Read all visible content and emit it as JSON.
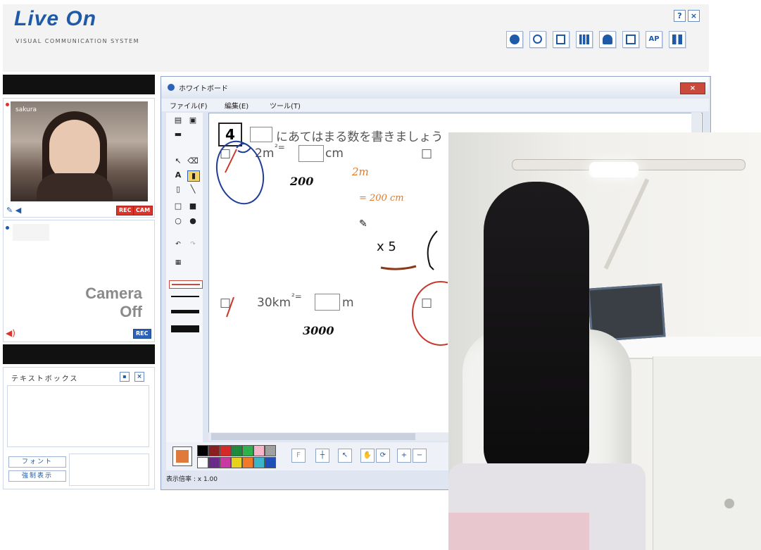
{
  "app": {
    "logo": "Live On",
    "tagline": "VISUAL COMMUNICATION SYSTEM",
    "help_button": "?",
    "close_button": "×",
    "toolbar": {
      "ap_label": "AP"
    },
    "accent": "#1f5aa8"
  },
  "video": {
    "participant_name": "sakura",
    "rec_label": "REC",
    "cam_label": "CAM",
    "camera_off_line1": "Camera",
    "camera_off_line2": "Off"
  },
  "textbox": {
    "title": "テキストボックス",
    "font_button": "フォント",
    "force_show_button": "強制表示"
  },
  "whiteboard": {
    "title": "ホワイトボード",
    "close_label": "×",
    "menu": [
      "ファイル(F)",
      "編集(E)",
      "ツール(T)"
    ],
    "question_number": "4",
    "instruction": "にあてはまる数を書きましょう",
    "q1_value": "2m",
    "q1_unit": "cm",
    "q3_value": "30km",
    "q3_unit": "m",
    "written_answer_1": "200",
    "written_answer_2": "3000",
    "note_line1": "2m",
    "note_line2": "= 200 cm",
    "note_multiplier": "x 5",
    "zoom_status": "表示倍率 : x 1.00",
    "palette": [
      "#ffffff",
      "#000000",
      "#8a1f1f",
      "#d42a2a",
      "#1f8a3a",
      "#2fb04a",
      "#f4b6c8",
      "#a0a0a0",
      "#6a2a8a",
      "#c83aa0",
      "#e6d21a",
      "#f07a2a",
      "#3ab6c8",
      "#1e4fb8"
    ],
    "current_color": "#e07a3a"
  }
}
